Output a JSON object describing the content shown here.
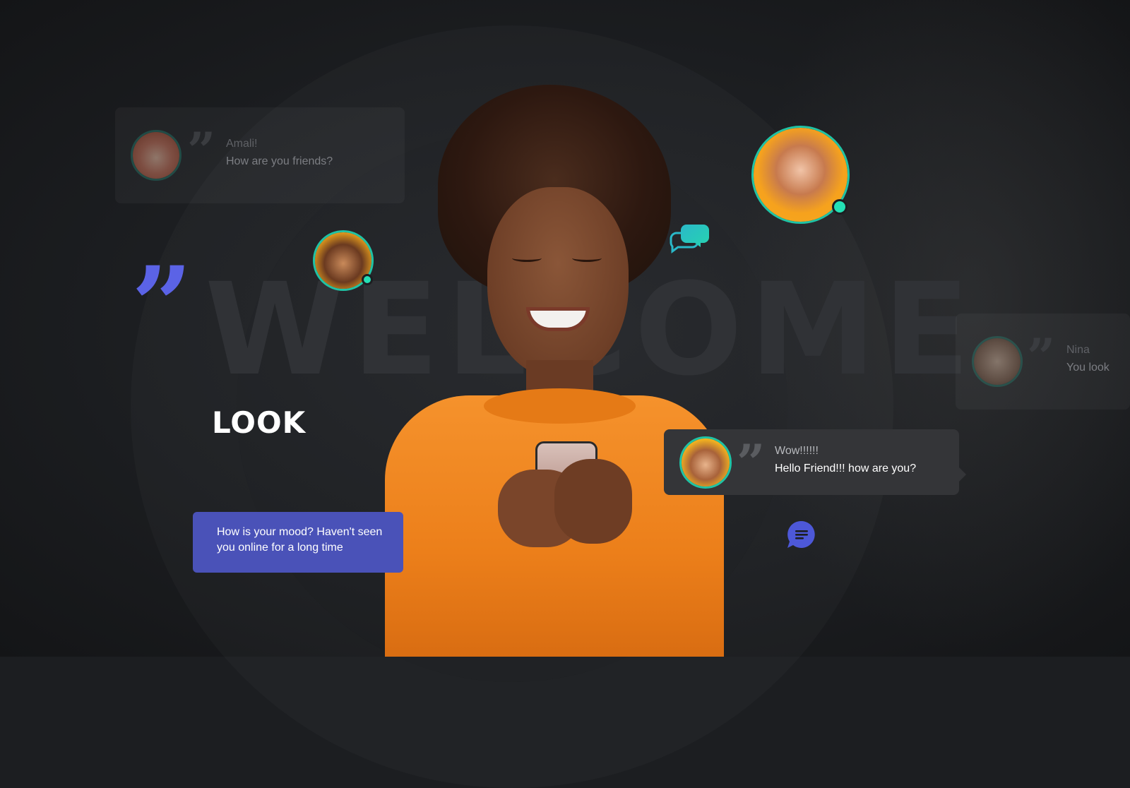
{
  "hero": {
    "background_word": "WELCOME",
    "headline": "LOOK"
  },
  "cards": {
    "amali": {
      "name": "Amali!",
      "message": "How are you friends?"
    },
    "nina": {
      "name": "Nina",
      "message": "You look"
    },
    "wow": {
      "name": "Wow!!!!!!",
      "message": "Hello Friend!!! how are you?"
    }
  },
  "bubble": {
    "message": "How is your mood? Haven't seen you online for a long time"
  },
  "icons": {
    "quote": "quote-icon",
    "chat_bubbles": "chat-bubbles-icon",
    "message": "message-icon"
  },
  "colors": {
    "accent_teal": "#1fc3a5",
    "accent_blue": "#4a52b8",
    "quote_purple": "#5b63e6",
    "background": "#1c1e21",
    "sweater_orange": "#f5922c"
  }
}
